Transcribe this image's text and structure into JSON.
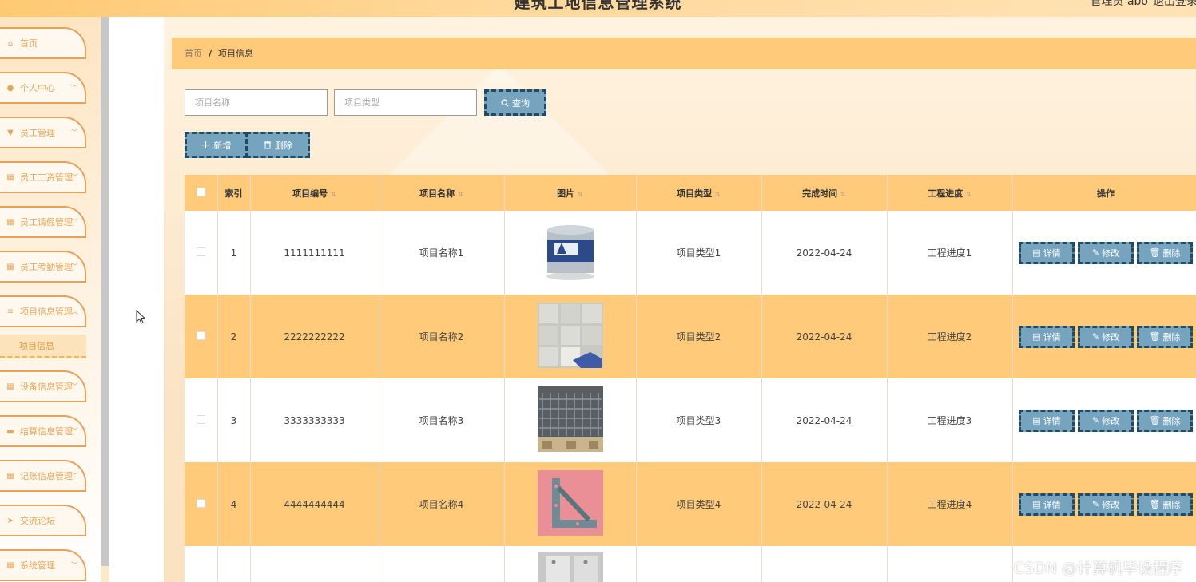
{
  "header": {
    "title": "建筑工地信息管理系统",
    "user_text": "管理员 abo",
    "logout_label": "退出登录"
  },
  "sidebar": {
    "items": [
      {
        "label": "首页",
        "icon": "home-icon",
        "glyph": "⌂",
        "chevron": false
      },
      {
        "label": "个人中心",
        "icon": "user-icon",
        "glyph": "●",
        "chevron": true
      },
      {
        "label": "员工管理",
        "icon": "trophy-icon",
        "glyph": "▼",
        "chevron": true
      },
      {
        "label": "员工工资管理",
        "icon": "grid-icon",
        "glyph": "▦",
        "chevron": true
      },
      {
        "label": "员工请假管理",
        "icon": "grid-icon",
        "glyph": "▦",
        "chevron": true
      },
      {
        "label": "员工考勤管理",
        "icon": "grid-icon",
        "glyph": "▦",
        "chevron": true
      },
      {
        "label": "项目信息管理",
        "icon": "list-icon",
        "glyph": "≡",
        "chevron": true
      },
      {
        "label": "设备信息管理",
        "icon": "grid-icon",
        "glyph": "▦",
        "chevron": true
      },
      {
        "label": "结算信息管理",
        "icon": "briefcase-icon",
        "glyph": "▬",
        "chevron": true
      },
      {
        "label": "记账信息管理",
        "icon": "grid-icon",
        "glyph": "▦",
        "chevron": true
      },
      {
        "label": "交流论坛",
        "icon": "send-icon",
        "glyph": "➤",
        "chevron": false
      },
      {
        "label": "系统管理",
        "icon": "grid-icon",
        "glyph": "▦",
        "chevron": true
      }
    ],
    "active_sub": "项目信息"
  },
  "breadcrumb": {
    "home": "首页",
    "separator": "/",
    "current": "项目信息"
  },
  "search": {
    "name_placeholder": "项目名称",
    "type_placeholder": "项目类型",
    "query_label": "查询"
  },
  "toolbar": {
    "add_label": "新增",
    "delete_label": "删除"
  },
  "table": {
    "columns": [
      "索引",
      "项目编号",
      "项目名称",
      "图片",
      "项目类型",
      "完成时间",
      "工程进度",
      "操作"
    ],
    "rows": [
      {
        "index": "1",
        "code": "1111111111",
        "name": "项目名称1",
        "image": "paint-bucket",
        "type": "项目类型1",
        "date": "2022-04-24",
        "progress": "工程进度1"
      },
      {
        "index": "2",
        "code": "2222222222",
        "name": "项目名称2",
        "image": "floor-tiles",
        "type": "项目类型2",
        "date": "2022-04-24",
        "progress": "工程进度2"
      },
      {
        "index": "3",
        "code": "3333333333",
        "name": "项目名称3",
        "image": "steel-mesh",
        "type": "项目类型3",
        "date": "2022-04-24",
        "progress": "工程进度3"
      },
      {
        "index": "4",
        "code": "4444444444",
        "name": "项目名称4",
        "image": "steel-bracket",
        "type": "项目类型4",
        "date": "2022-04-24",
        "progress": "工程进度4"
      }
    ],
    "actions": {
      "detail": "详情",
      "edit": "修改",
      "delete": "删除"
    }
  },
  "watermark": "CSDN @计算机毕设程序",
  "colors": {
    "accent": "#ffcb7a",
    "button": "#76a4bf",
    "button_border": "#234a63",
    "menu_text": "#e5a75b"
  }
}
